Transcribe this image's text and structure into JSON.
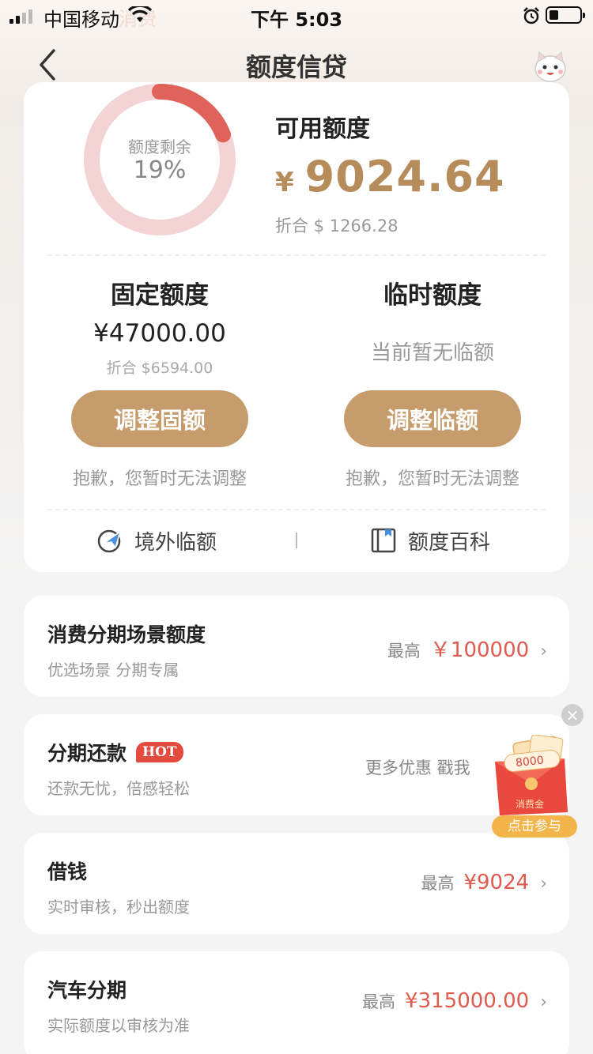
{
  "status_bar": {
    "carrier": "中国移动",
    "time": "下午 5:03",
    "ghost_text": "消费"
  },
  "nav": {
    "title": "额度信贷"
  },
  "quota": {
    "ring_label": "额度剩余",
    "remaining_percent_text": "19%",
    "remaining_fraction": 0.19,
    "available_title": "可用额度",
    "available_currency": "¥",
    "available_value": "9024.64",
    "available_usd": "折合 $ 1266.28",
    "fixed": {
      "title": "固定额度",
      "amount": "¥47000.00",
      "usd": "折合 $6594.00",
      "button": "调整固额",
      "note": "抱歉，您暂时无法调整"
    },
    "temporary": {
      "title": "临时额度",
      "status": "当前暂无临额",
      "button": "调整临额",
      "note": "抱歉，您暂时无法调整"
    },
    "links": {
      "overseas": "境外临额",
      "wiki": "额度百科"
    }
  },
  "list": [
    {
      "title": "消费分期场景额度",
      "sub": "优选场景 分期专属",
      "prefix": "最高",
      "amount": "￥100000",
      "arrow": "›"
    },
    {
      "title": "分期还款",
      "badge": "HOT",
      "sub": "还款无忧，倍感轻松",
      "more": "更多优惠 戳我",
      "arrow": "›"
    },
    {
      "title": "借钱",
      "sub": "实时审核，秒出额度",
      "prefix": "最高",
      "amount": "¥9024",
      "arrow": "›"
    },
    {
      "title": "汽车分期",
      "sub": "实际额度以审核为准",
      "prefix": "最高",
      "amount": "¥315000.00",
      "arrow": "›"
    }
  ],
  "float_ad": {
    "amount": "8000",
    "tag": "消费金",
    "label": "点击参与",
    "close": "×"
  },
  "colors": {
    "gold": "#c79c6c",
    "amount_gold": "#b58c5a",
    "red": "#e05a4e",
    "ring_track": "#f3d3d3",
    "ring_fill": "#e0635b"
  }
}
